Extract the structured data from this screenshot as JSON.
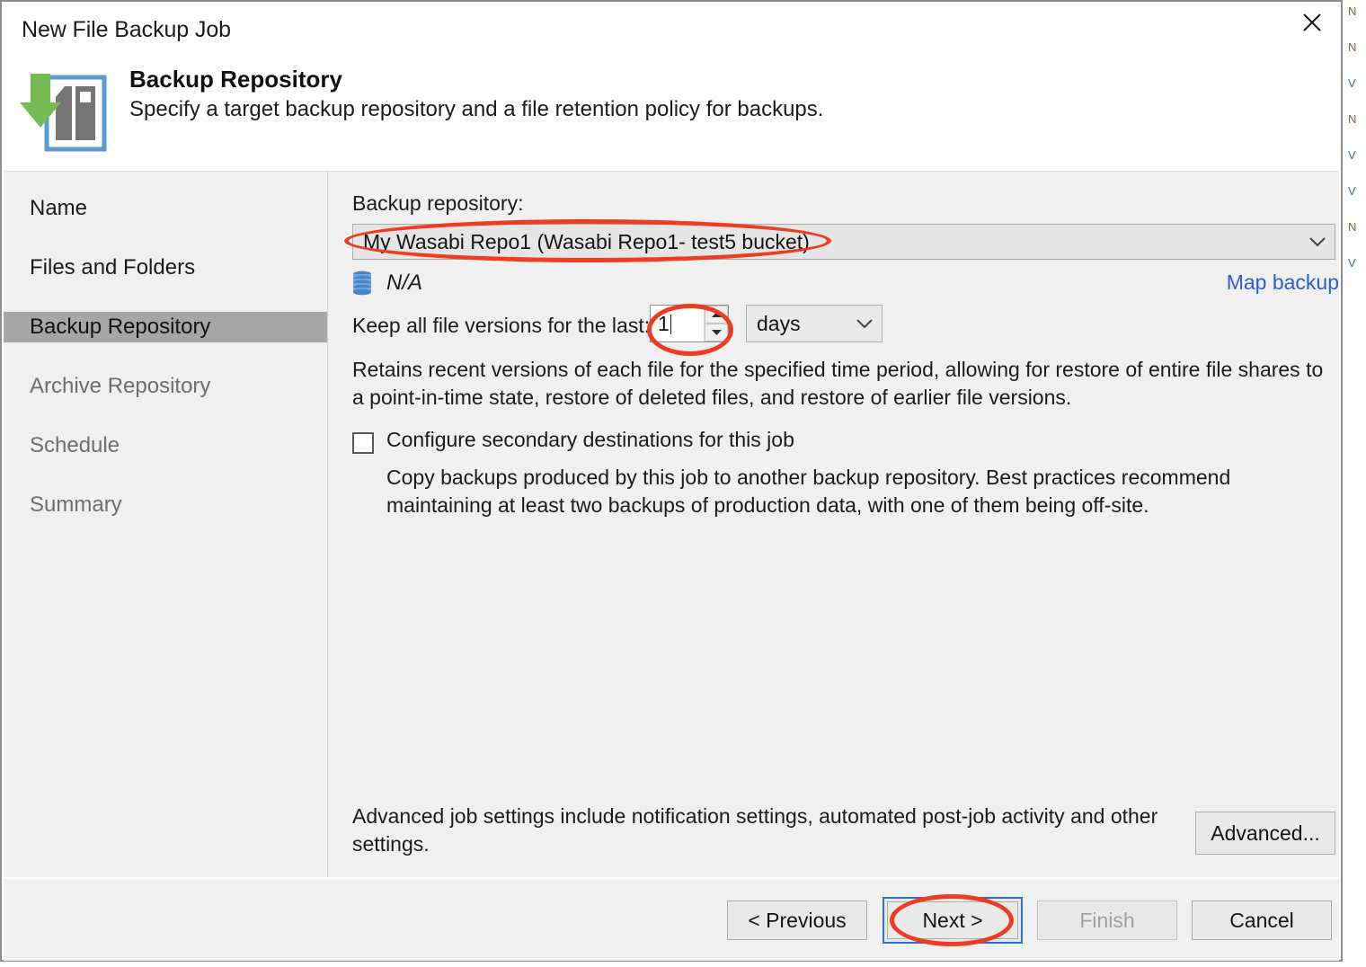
{
  "window": {
    "title": "New File Backup Job",
    "close_icon": "close-icon"
  },
  "header": {
    "icon": "backup-repository-icon",
    "title": "Backup Repository",
    "subtitle": "Specify a target backup repository and a file retention policy for backups."
  },
  "sidebar": {
    "items": [
      {
        "label": "Name",
        "state": "done"
      },
      {
        "label": "Files and Folders",
        "state": "done"
      },
      {
        "label": "Backup Repository",
        "state": "current"
      },
      {
        "label": "Archive Repository",
        "state": "pending"
      },
      {
        "label": "Schedule",
        "state": "pending"
      },
      {
        "label": "Summary",
        "state": "pending"
      }
    ]
  },
  "content": {
    "repository_label": "Backup repository:",
    "repository_value": "My Wasabi Repo1 (Wasabi Repo1- test5 bucket)",
    "repository_icon": "database-icon",
    "capacity_value": "N/A",
    "map_backup_link": "Map backup",
    "keep_label": "Keep all file versions for the last:",
    "keep_value": "1",
    "keep_unit": "days",
    "spinner_up_icon": "chevron-up-icon",
    "spinner_down_icon": "chevron-down-icon",
    "combo_arrow_icon": "chevron-down-icon",
    "retention_description": "Retains recent versions of each file for the specified time period, allowing for restore of entire file shares to a point-in-time state, restore of deleted files, and restore of earlier file versions.",
    "secondary_checkbox_label": "Configure secondary destinations for this job",
    "secondary_checkbox_checked": false,
    "secondary_description": "Copy backups produced by this job to another backup repository. Best practices recommend maintaining at least two backups of production data, with one of them being off-site.",
    "advanced_description": "Advanced job settings include notification settings, automated post-job activity and other settings.",
    "advanced_button": "Advanced..."
  },
  "footer": {
    "previous": "< Previous",
    "next": "Next >",
    "finish": "Finish",
    "cancel": "Cancel",
    "finish_disabled": true
  },
  "annotations": {
    "color": "#ef3b20",
    "focus_color": "#2a6fd4",
    "shapes": [
      "repository-combobox-highlight",
      "retention-value-highlight",
      "next-button-highlight"
    ]
  },
  "colors": {
    "link": "#2b5bd7",
    "dialog_bg": "#f0f0f0",
    "selected_nav": "#a6a6a6",
    "accent_green": "#76bb52",
    "accent_blue": "#5b9bd5"
  },
  "background_window": {
    "fragments": [
      "N",
      "N",
      "V",
      "N",
      "V",
      "V",
      "N",
      "V"
    ]
  }
}
